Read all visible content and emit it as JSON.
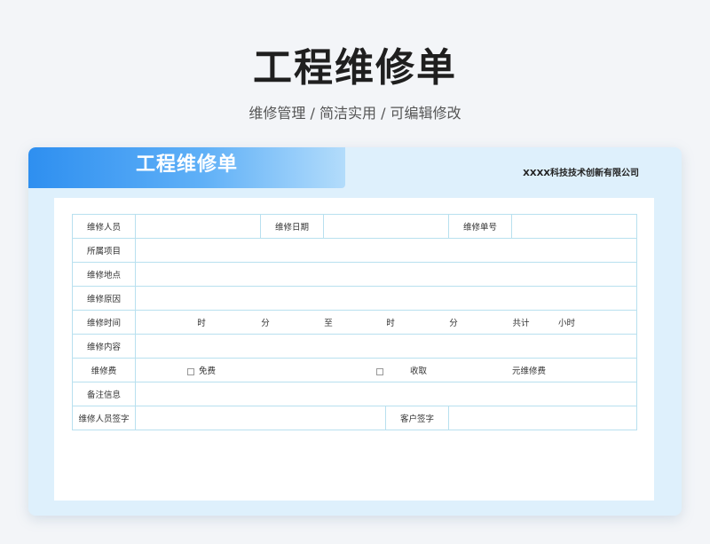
{
  "page": {
    "title": "工程维修单",
    "subtitle": "维修管理 / 简洁实用 /  可编辑修改"
  },
  "form": {
    "banner_title": "工程维修单",
    "company": "XXXX科技技术创新有限公司",
    "labels": {
      "staff": "维修人员",
      "date": "维修日期",
      "order_no": "维修单号",
      "project": "所属项目",
      "location": "维修地点",
      "reason": "维修原因",
      "time": "维修时间",
      "content": "维修内容",
      "fee": "维修费",
      "remark": "备注信息",
      "staff_sign": "维修人员签字",
      "customer_sign": "客户签字"
    },
    "time_row": {
      "hour_1": "时",
      "minute_1": "分",
      "to": "至",
      "hour_2": "时",
      "minute_2": "分",
      "total": "共计",
      "hours": "小时"
    },
    "fee_row": {
      "free": "免费",
      "charge": "收取",
      "unit": "元维修费"
    }
  }
}
